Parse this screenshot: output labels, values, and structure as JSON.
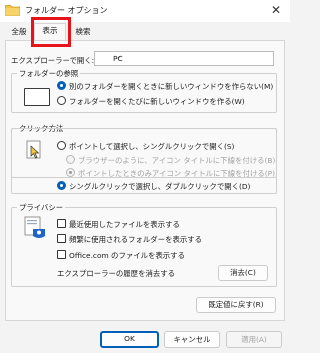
{
  "window": {
    "title": "フォルダー オプション",
    "close_glyph": "✕"
  },
  "tabs": [
    "全般",
    "表示",
    "検索"
  ],
  "open_in": {
    "label": "エクスプローラーで開く:",
    "value": "PC"
  },
  "browse": {
    "title": "フォルダーの参照",
    "options": [
      "別のフォルダーを開くときに新しいウィンドウを作らない(M)",
      "フォルダーを開くたびに新しいウィンドウを作る(W)"
    ],
    "selected": 0
  },
  "click": {
    "title": "クリック方法",
    "options": [
      "ポイントして選択し、シングルクリックで開く(S)",
      "ブラウザーのように、アイコン タイトルに下線を付ける(B)",
      "ポイントしたときのみアイコン タイトルに下線を付ける(P)",
      "シングルクリックで選択し、ダブルクリックで開く(D)"
    ],
    "selected": 3
  },
  "privacy": {
    "title": "プライバシー",
    "checks": [
      "最近使用したファイルを表示する",
      "頻繁に使用されるフォルダーを表示する",
      "Office.com のファイルを表示する"
    ],
    "clear_label": "エクスプローラーの履歴を消去する",
    "clear_button": "消去(C)"
  },
  "restore_button": "既定値に戻す(R)",
  "footer": {
    "ok": "OK",
    "cancel": "キャンセル",
    "apply": "適用(A)"
  },
  "colors": {
    "accent": "#005fb8",
    "highlight": "#e8141c"
  }
}
